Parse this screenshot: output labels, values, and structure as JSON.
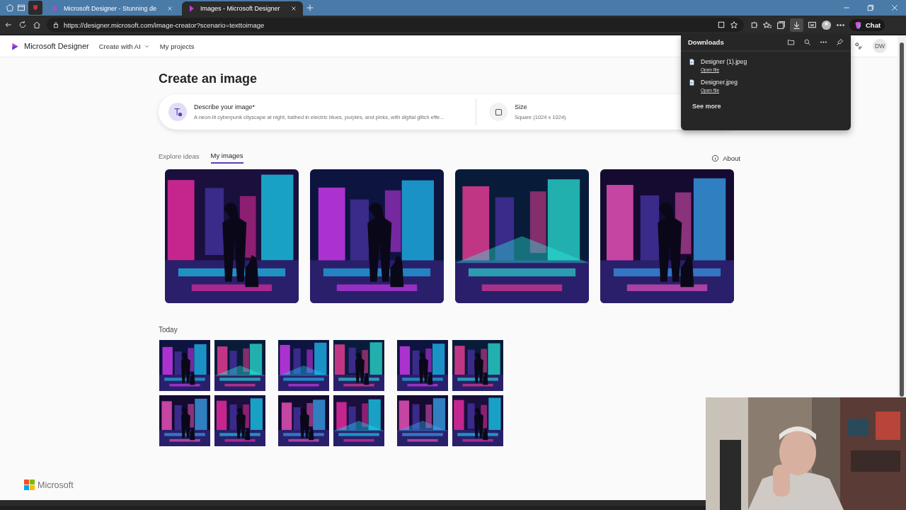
{
  "browser": {
    "tabs": [
      {
        "title": "Microsoft Designer - Stunning de",
        "selected": false
      },
      {
        "title": "Images - Microsoft Designer",
        "selected": true
      }
    ],
    "address": "https://designer.microsoft.com/image-creator?scenario=texttoimage",
    "chat_label": "Chat"
  },
  "app": {
    "brand": "Microsoft Designer",
    "nav": [
      "Create with AI",
      "My projects"
    ],
    "avatar": "DW"
  },
  "page": {
    "title": "Create an image",
    "prompt": {
      "label": "Describe your image*",
      "value": "A neon-lit cyberpunk cityscape at night, bathed in electric blues, purples, and pinks, with digital glitch effe..."
    },
    "size": {
      "label": "Size",
      "value": "Square (1024 x 1024)"
    },
    "tabs": [
      {
        "label": "Explore ideas",
        "selected": false
      },
      {
        "label": "My images",
        "selected": true
      }
    ],
    "about": "About",
    "section": "Today",
    "footer": "Microsoft"
  },
  "downloads": {
    "title": "Downloads",
    "items": [
      {
        "name": "Designer (1).jpeg",
        "action": "Open file"
      },
      {
        "name": "Designer.jpeg",
        "action": "Open file"
      }
    ],
    "see_more": "See more"
  }
}
